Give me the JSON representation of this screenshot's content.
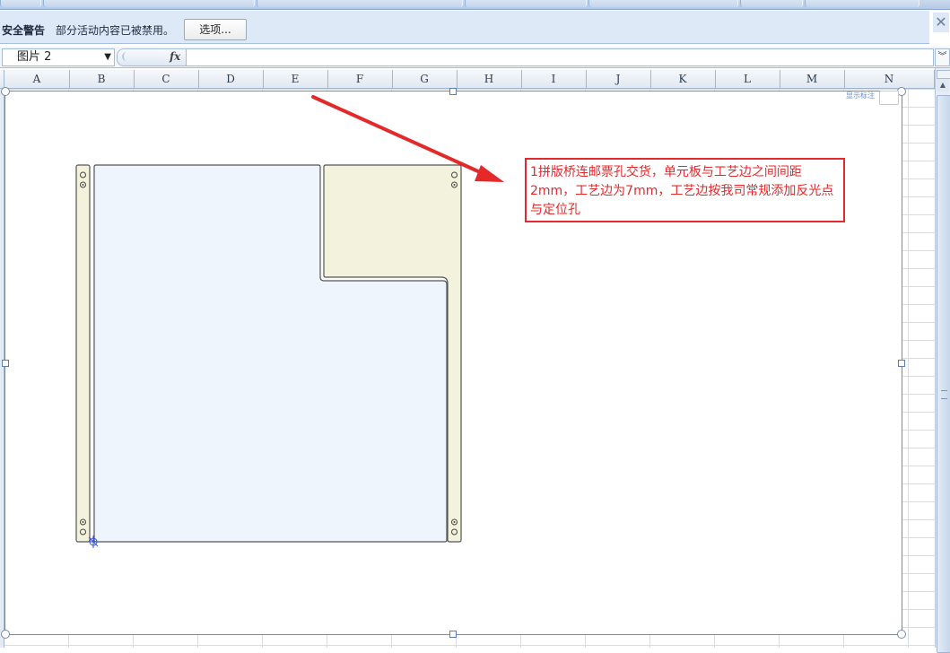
{
  "security_bar": {
    "title": "安全警告",
    "message": "部分活动内容已被禁用。",
    "options_button": "选项..."
  },
  "formula_bar": {
    "name_box": "图片 2",
    "fx": "fx",
    "formula": ""
  },
  "columns": [
    "A",
    "B",
    "C",
    "D",
    "E",
    "F",
    "G",
    "H",
    "I",
    "J",
    "K",
    "L",
    "M",
    "N"
  ],
  "picture": {
    "corner_note": "显示标注",
    "annotation": "1拼版桥连邮票孔交货，单元板与工艺边之间间距2mm，工艺边为7mm，工艺边按我司常规添加反光点与定位孔"
  },
  "colors": {
    "annotation_red": "#e3292a",
    "board_fill": "#eef5fc",
    "rail_fill": "#f3f3dd",
    "outline": "#555555"
  },
  "icons": {
    "close": "close-icon",
    "dropdown": "chevron-down-icon",
    "expand": "double-chevron-down-icon"
  }
}
